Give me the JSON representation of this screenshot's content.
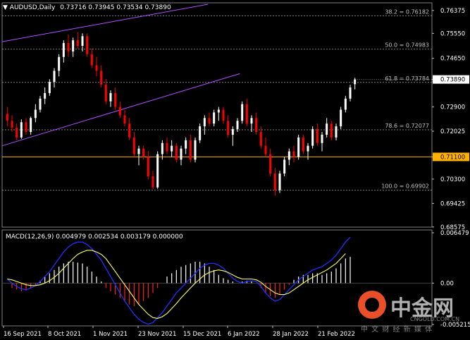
{
  "header": {
    "symbol_label": "AUDUSD,Daily",
    "ohlc": "0.73716 0.73945 0.73534 0.73890"
  },
  "macd_header": "MACD(12,26,9) 0.004979 0.002534 0.003179 0.000000",
  "colors": {
    "background": "#000000",
    "grid": "#808080",
    "bull_candle": "#ffffff",
    "bear_candle": "#ff0000",
    "channel": "#b050ff",
    "support_line": "#ffb000",
    "macd_line": "#2030ff",
    "signal_line": "#ffff66"
  },
  "price_axis": {
    "ticks": [
      "0.76375",
      "0.75550",
      "0.74650",
      "0.73890",
      "0.72900",
      "0.72025",
      "0.71100",
      "0.70300",
      "0.69425",
      "0.68575"
    ],
    "current_price_label": "0.73890",
    "support_label": "0.71100"
  },
  "fib_levels": [
    {
      "label": "38.2 = 0.76182"
    },
    {
      "label": "50.0 = 0.74983"
    },
    {
      "label": "61.8 = 0.73784"
    },
    {
      "label": "78.6 = 0.72077"
    },
    {
      "label": "100.0 = 0.69902"
    }
  ],
  "macd_axis": {
    "ticks": [
      "0.006479",
      "0.00",
      "-0.005215"
    ]
  },
  "time_axis": {
    "labels": [
      "16 Sep 2021",
      "8 Oct 2021",
      "1 Nov 2021",
      "23 Nov 2021",
      "15 Dec 2021",
      "6 Jan 2022",
      "28 Jan 2022",
      "21 Feb 2022"
    ]
  },
  "watermark": {
    "logo_text": "中金网",
    "url": "CNGOLD.COM.CN",
    "tagline": "中 文 财 经 新 媒 体"
  },
  "chart_data": {
    "type": "candlestick",
    "title": "AUDUSD,Daily",
    "ylim": [
      0.6857,
      0.7665
    ],
    "candles": [
      [
        0.7265,
        0.729,
        0.722,
        0.724
      ],
      [
        0.724,
        0.726,
        0.72,
        0.7215
      ],
      [
        0.7215,
        0.723,
        0.717,
        0.718
      ],
      [
        0.718,
        0.7245,
        0.7175,
        0.7235
      ],
      [
        0.7235,
        0.725,
        0.719,
        0.72
      ],
      [
        0.72,
        0.7255,
        0.719,
        0.725
      ],
      [
        0.725,
        0.73,
        0.7235,
        0.728
      ],
      [
        0.728,
        0.733,
        0.727,
        0.732
      ],
      [
        0.732,
        0.736,
        0.73,
        0.734
      ],
      [
        0.734,
        0.739,
        0.733,
        0.738
      ],
      [
        0.738,
        0.743,
        0.736,
        0.742
      ],
      [
        0.742,
        0.748,
        0.74,
        0.747
      ],
      [
        0.747,
        0.753,
        0.745,
        0.752
      ],
      [
        0.752,
        0.755,
        0.747,
        0.749
      ],
      [
        0.749,
        0.754,
        0.747,
        0.753
      ],
      [
        0.753,
        0.756,
        0.75,
        0.751
      ],
      [
        0.751,
        0.7555,
        0.749,
        0.7545
      ],
      [
        0.7545,
        0.7555,
        0.747,
        0.748
      ],
      [
        0.748,
        0.75,
        0.743,
        0.744
      ],
      [
        0.744,
        0.747,
        0.74,
        0.742
      ],
      [
        0.742,
        0.744,
        0.736,
        0.737
      ],
      [
        0.737,
        0.739,
        0.73,
        0.731
      ],
      [
        0.731,
        0.735,
        0.729,
        0.734
      ],
      [
        0.734,
        0.736,
        0.728,
        0.729
      ],
      [
        0.729,
        0.731,
        0.725,
        0.726
      ],
      [
        0.726,
        0.728,
        0.722,
        0.723
      ],
      [
        0.723,
        0.725,
        0.717,
        0.718
      ],
      [
        0.718,
        0.72,
        0.711,
        0.712
      ],
      [
        0.712,
        0.715,
        0.708,
        0.714
      ],
      [
        0.714,
        0.715,
        0.71,
        0.711
      ],
      [
        0.711,
        0.713,
        0.703,
        0.704
      ],
      [
        0.704,
        0.706,
        0.6995,
        0.7
      ],
      [
        0.7,
        0.713,
        0.6995,
        0.712
      ],
      [
        0.712,
        0.717,
        0.71,
        0.716
      ],
      [
        0.716,
        0.718,
        0.712,
        0.713
      ],
      [
        0.713,
        0.717,
        0.711,
        0.715
      ],
      [
        0.715,
        0.716,
        0.709,
        0.71
      ],
      [
        0.71,
        0.715,
        0.708,
        0.714
      ],
      [
        0.714,
        0.718,
        0.712,
        0.717
      ],
      [
        0.717,
        0.719,
        0.709,
        0.71
      ],
      [
        0.71,
        0.718,
        0.709,
        0.717
      ],
      [
        0.717,
        0.723,
        0.716,
        0.722
      ],
      [
        0.722,
        0.726,
        0.719,
        0.725
      ],
      [
        0.725,
        0.727,
        0.722,
        0.723
      ],
      [
        0.723,
        0.728,
        0.722,
        0.727
      ],
      [
        0.727,
        0.729,
        0.724,
        0.728
      ],
      [
        0.728,
        0.729,
        0.723,
        0.724
      ],
      [
        0.724,
        0.726,
        0.718,
        0.719
      ],
      [
        0.719,
        0.722,
        0.715,
        0.721
      ],
      [
        0.721,
        0.725,
        0.72,
        0.724
      ],
      [
        0.724,
        0.731,
        0.723,
        0.73
      ],
      [
        0.73,
        0.732,
        0.722,
        0.723
      ],
      [
        0.723,
        0.726,
        0.72,
        0.725
      ],
      [
        0.725,
        0.727,
        0.719,
        0.72
      ],
      [
        0.72,
        0.722,
        0.714,
        0.715
      ],
      [
        0.715,
        0.718,
        0.711,
        0.712
      ],
      [
        0.712,
        0.714,
        0.704,
        0.705
      ],
      [
        0.705,
        0.707,
        0.697,
        0.699
      ],
      [
        0.699,
        0.706,
        0.698,
        0.705
      ],
      [
        0.705,
        0.711,
        0.704,
        0.71
      ],
      [
        0.71,
        0.714,
        0.708,
        0.713
      ],
      [
        0.713,
        0.715,
        0.709,
        0.711
      ],
      [
        0.711,
        0.719,
        0.71,
        0.718
      ],
      [
        0.718,
        0.719,
        0.712,
        0.713
      ],
      [
        0.713,
        0.716,
        0.71,
        0.715
      ],
      [
        0.715,
        0.722,
        0.714,
        0.721
      ],
      [
        0.721,
        0.723,
        0.715,
        0.716
      ],
      [
        0.716,
        0.72,
        0.713,
        0.719
      ],
      [
        0.719,
        0.725,
        0.718,
        0.723
      ],
      [
        0.723,
        0.724,
        0.717,
        0.718
      ],
      [
        0.718,
        0.723,
        0.717,
        0.722
      ],
      [
        0.722,
        0.729,
        0.721,
        0.728
      ],
      [
        0.728,
        0.733,
        0.727,
        0.732
      ],
      [
        0.732,
        0.737,
        0.731,
        0.736
      ],
      [
        0.7372,
        0.7395,
        0.7353,
        0.7389
      ]
    ],
    "macd_histogram": [
      0.0,
      -0.0006,
      -0.0008,
      -0.001,
      -0.0009,
      -0.0006,
      -0.0003,
      0.0003,
      0.0008,
      0.0012,
      0.0016,
      0.002,
      0.0024,
      0.0026,
      0.0026,
      0.0025,
      0.0024,
      0.002,
      0.0014,
      0.0008,
      0.0002,
      -0.0006,
      -0.001,
      -0.0014,
      -0.0018,
      -0.0022,
      -0.0026,
      -0.0028,
      -0.0026,
      -0.0022,
      -0.0018,
      -0.0012,
      -0.0006,
      0.0,
      0.0008,
      0.0012,
      0.0016,
      0.002,
      0.0022,
      0.0024,
      0.0026,
      0.0026,
      0.0024,
      0.002,
      0.0016,
      0.001,
      0.0006,
      0.0004,
      0.0002,
      0.0,
      0.0002,
      0.0003,
      0.0002,
      0.0,
      -0.0006,
      -0.0012,
      -0.0016,
      -0.0018,
      -0.0014,
      -0.0008,
      -0.0002,
      0.0004,
      0.0008,
      0.001,
      0.001,
      0.0012,
      0.0012,
      0.001,
      0.0012,
      0.0014,
      0.0018,
      0.0024,
      0.003,
      0.0032
    ],
    "macd_line": [
      0.0005,
      0.0,
      -0.0004,
      -0.0007,
      -0.0008,
      -0.0006,
      -0.0003,
      0.0002,
      0.0008,
      0.0014,
      0.0022,
      0.003,
      0.0038,
      0.0044,
      0.0048,
      0.005,
      0.005,
      0.0047,
      0.0042,
      0.0035,
      0.0028,
      0.0018,
      0.0008,
      -0.0002,
      -0.0012,
      -0.0022,
      -0.003,
      -0.0038,
      -0.0044,
      -0.0048,
      -0.005,
      -0.0048,
      -0.0042,
      -0.0036,
      -0.0028,
      -0.002,
      -0.0012,
      -0.0006,
      0.0,
      0.0006,
      0.0012,
      0.0018,
      0.0022,
      0.0024,
      0.0024,
      0.0022,
      0.0018,
      0.0012,
      0.0006,
      0.0002,
      0.0,
      0.0002,
      0.0003,
      0.0002,
      -0.0004,
      -0.0012,
      -0.0018,
      -0.0022,
      -0.002,
      -0.0014,
      -0.0008,
      -0.0002,
      0.0004,
      0.0008,
      0.0012,
      0.0016,
      0.0018,
      0.002,
      0.0024,
      0.0028,
      0.0034,
      0.0042,
      0.005,
      0.0056
    ],
    "signal_line": [
      0.0005,
      0.0004,
      0.0002,
      0.0,
      -0.0002,
      -0.0003,
      -0.0003,
      -0.0002,
      0.0,
      0.0003,
      0.0007,
      0.0012,
      0.0018,
      0.0024,
      0.003,
      0.0035,
      0.0038,
      0.004,
      0.004,
      0.0038,
      0.0035,
      0.003,
      0.0022,
      0.0014,
      0.0006,
      -0.0002,
      -0.001,
      -0.0018,
      -0.0026,
      -0.0032,
      -0.0038,
      -0.0042,
      -0.0043,
      -0.0041,
      -0.0037,
      -0.0031,
      -0.0025,
      -0.0018,
      -0.0012,
      -0.0006,
      0.0,
      0.0005,
      0.001,
      0.0013,
      0.0015,
      0.0016,
      0.0015,
      0.0013,
      0.001,
      0.0007,
      0.0005,
      0.0005,
      0.0005,
      0.0004,
      0.0001,
      -0.0004,
      -0.0008,
      -0.0012,
      -0.0014,
      -0.0014,
      -0.0012,
      -0.0008,
      -0.0004,
      0.0,
      0.0004,
      0.0007,
      0.001,
      0.0013,
      0.0016,
      0.002,
      0.0024,
      0.003,
      0.0036
    ],
    "macd_ylim": [
      -0.005215,
      0.006479
    ]
  }
}
